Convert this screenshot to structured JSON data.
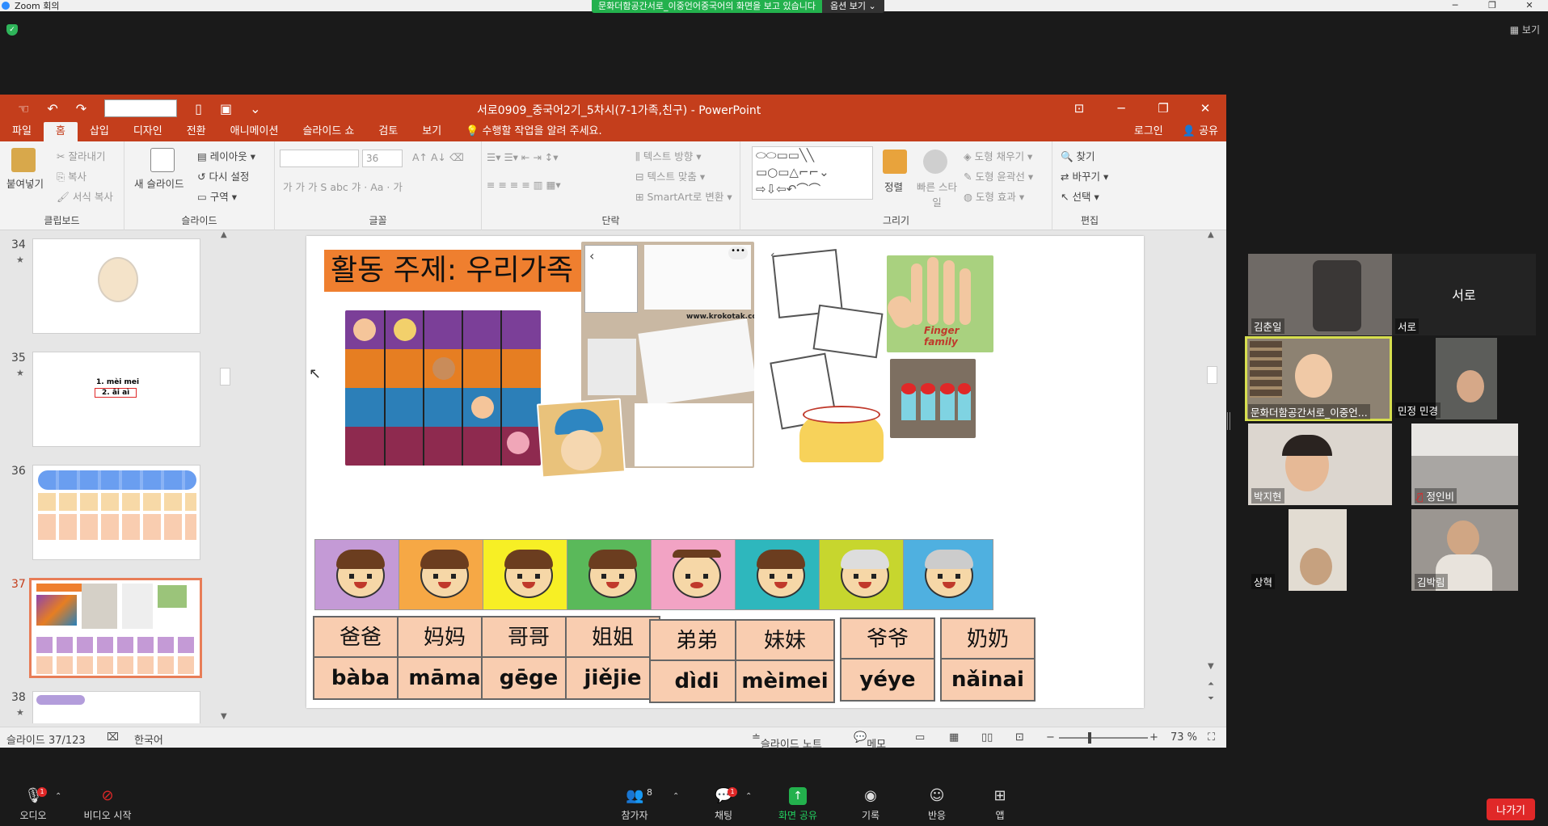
{
  "zoom": {
    "title": "Zoom 회의",
    "share_banner": "문화더함공간서로_이중언어중국어의 화면을 보고 있습니다",
    "view_options": "옵션 보기",
    "view_label": "보기",
    "toolbar": [
      {
        "label": "오디오",
        "icon": "microphone-icon",
        "badge": "1"
      },
      {
        "label": "비디오 시작",
        "icon": "video-off-icon",
        "badge": ""
      },
      {
        "label": "참가자",
        "icon": "participants-icon",
        "count": "8"
      },
      {
        "label": "채팅",
        "icon": "chat-icon",
        "badge": "1"
      },
      {
        "label": "화면 공유",
        "icon": "share-screen-icon"
      },
      {
        "label": "기록",
        "icon": "record-icon"
      },
      {
        "label": "반응",
        "icon": "reaction-icon"
      },
      {
        "label": "앱",
        "icon": "apps-icon"
      }
    ],
    "leave": "나가기",
    "participants": [
      {
        "name": "김춘일",
        "video": true
      },
      {
        "name": "서로",
        "video": false,
        "center": "서로"
      },
      {
        "name": "문화더함공간서로_이중언...",
        "video": true,
        "speaking": true
      },
      {
        "name": "민정 민경",
        "video": true
      },
      {
        "name": "박지현",
        "video": true
      },
      {
        "name": "정인비",
        "video": true
      },
      {
        "name": "상혁",
        "video": true
      },
      {
        "name": "김박림",
        "video": true
      }
    ]
  },
  "ppt": {
    "doc_title": "서로0909_중국어2기_5차시(7-1가족,친구) - PowerPoint",
    "tabs": [
      "파일",
      "홈",
      "삽입",
      "디자인",
      "전환",
      "애니메이션",
      "슬라이드 쇼",
      "검토",
      "보기"
    ],
    "tell_me": "수행할 작업을 알려 주세요.",
    "login": "로그인",
    "share": "공유",
    "ribbon": {
      "paste": "붙여넣기",
      "cut": "잘라내기",
      "copy": "복사",
      "format_painter": "서식 복사",
      "clipboard": "클립보드",
      "new_slide": "새 슬라이드",
      "layout": "레이아웃",
      "reset": "다시 설정",
      "section": "구역",
      "slides": "슬라이드",
      "font_size": "36",
      "font": "글꼴",
      "text_direction": "텍스트 방향",
      "align_text": "텍스트 맞춤",
      "smartart": "SmartArt로 변환",
      "paragraph": "단락",
      "arrange": "정렬",
      "quick_styles": "빠른 스타일",
      "shape_fill": "도형 채우기",
      "shape_outline": "도형 윤곽선",
      "shape_effects": "도형 효과",
      "drawing": "그리기",
      "find": "찾기",
      "replace": "바꾸기",
      "select": "선택",
      "editing": "편집"
    },
    "thumbs": [
      {
        "num": "34"
      },
      {
        "num": "35",
        "text1": "1. mèi mei",
        "text2": "2. āi aì"
      },
      {
        "num": "36"
      },
      {
        "num": "37",
        "active": true
      },
      {
        "num": "38"
      }
    ],
    "slide": {
      "title": "활동 주제: 우리가족",
      "krokotak": "www.krokotak.com",
      "finger_family": "Finger family",
      "cards": [
        {
          "hanzi": "爸爸",
          "pinyin": "bàba",
          "bg": "#c49ad6"
        },
        {
          "hanzi": "妈妈",
          "pinyin": "māma",
          "bg": "#f6a845"
        },
        {
          "hanzi": "哥哥",
          "pinyin": "gēge",
          "bg": "#f7ef25"
        },
        {
          "hanzi": "姐姐",
          "pinyin": "jiějie",
          "bg": "#5ab95a"
        },
        {
          "hanzi": "弟弟",
          "pinyin": "dìdi",
          "bg": "#f2a3c4"
        },
        {
          "hanzi": "妹妹",
          "pinyin": "mèimei",
          "bg": "#2eb7bd"
        },
        {
          "hanzi": "爷爷",
          "pinyin": "yéye",
          "bg": "#c7d62e"
        },
        {
          "hanzi": "奶奶",
          "pinyin": "nǎinai",
          "bg": "#4fb0e0"
        }
      ]
    },
    "status": {
      "slide_pos": "슬라이드 37/123",
      "language": "한국어",
      "notes": "슬라이드 노트",
      "comments": "메모",
      "zoom": "73 %"
    }
  }
}
